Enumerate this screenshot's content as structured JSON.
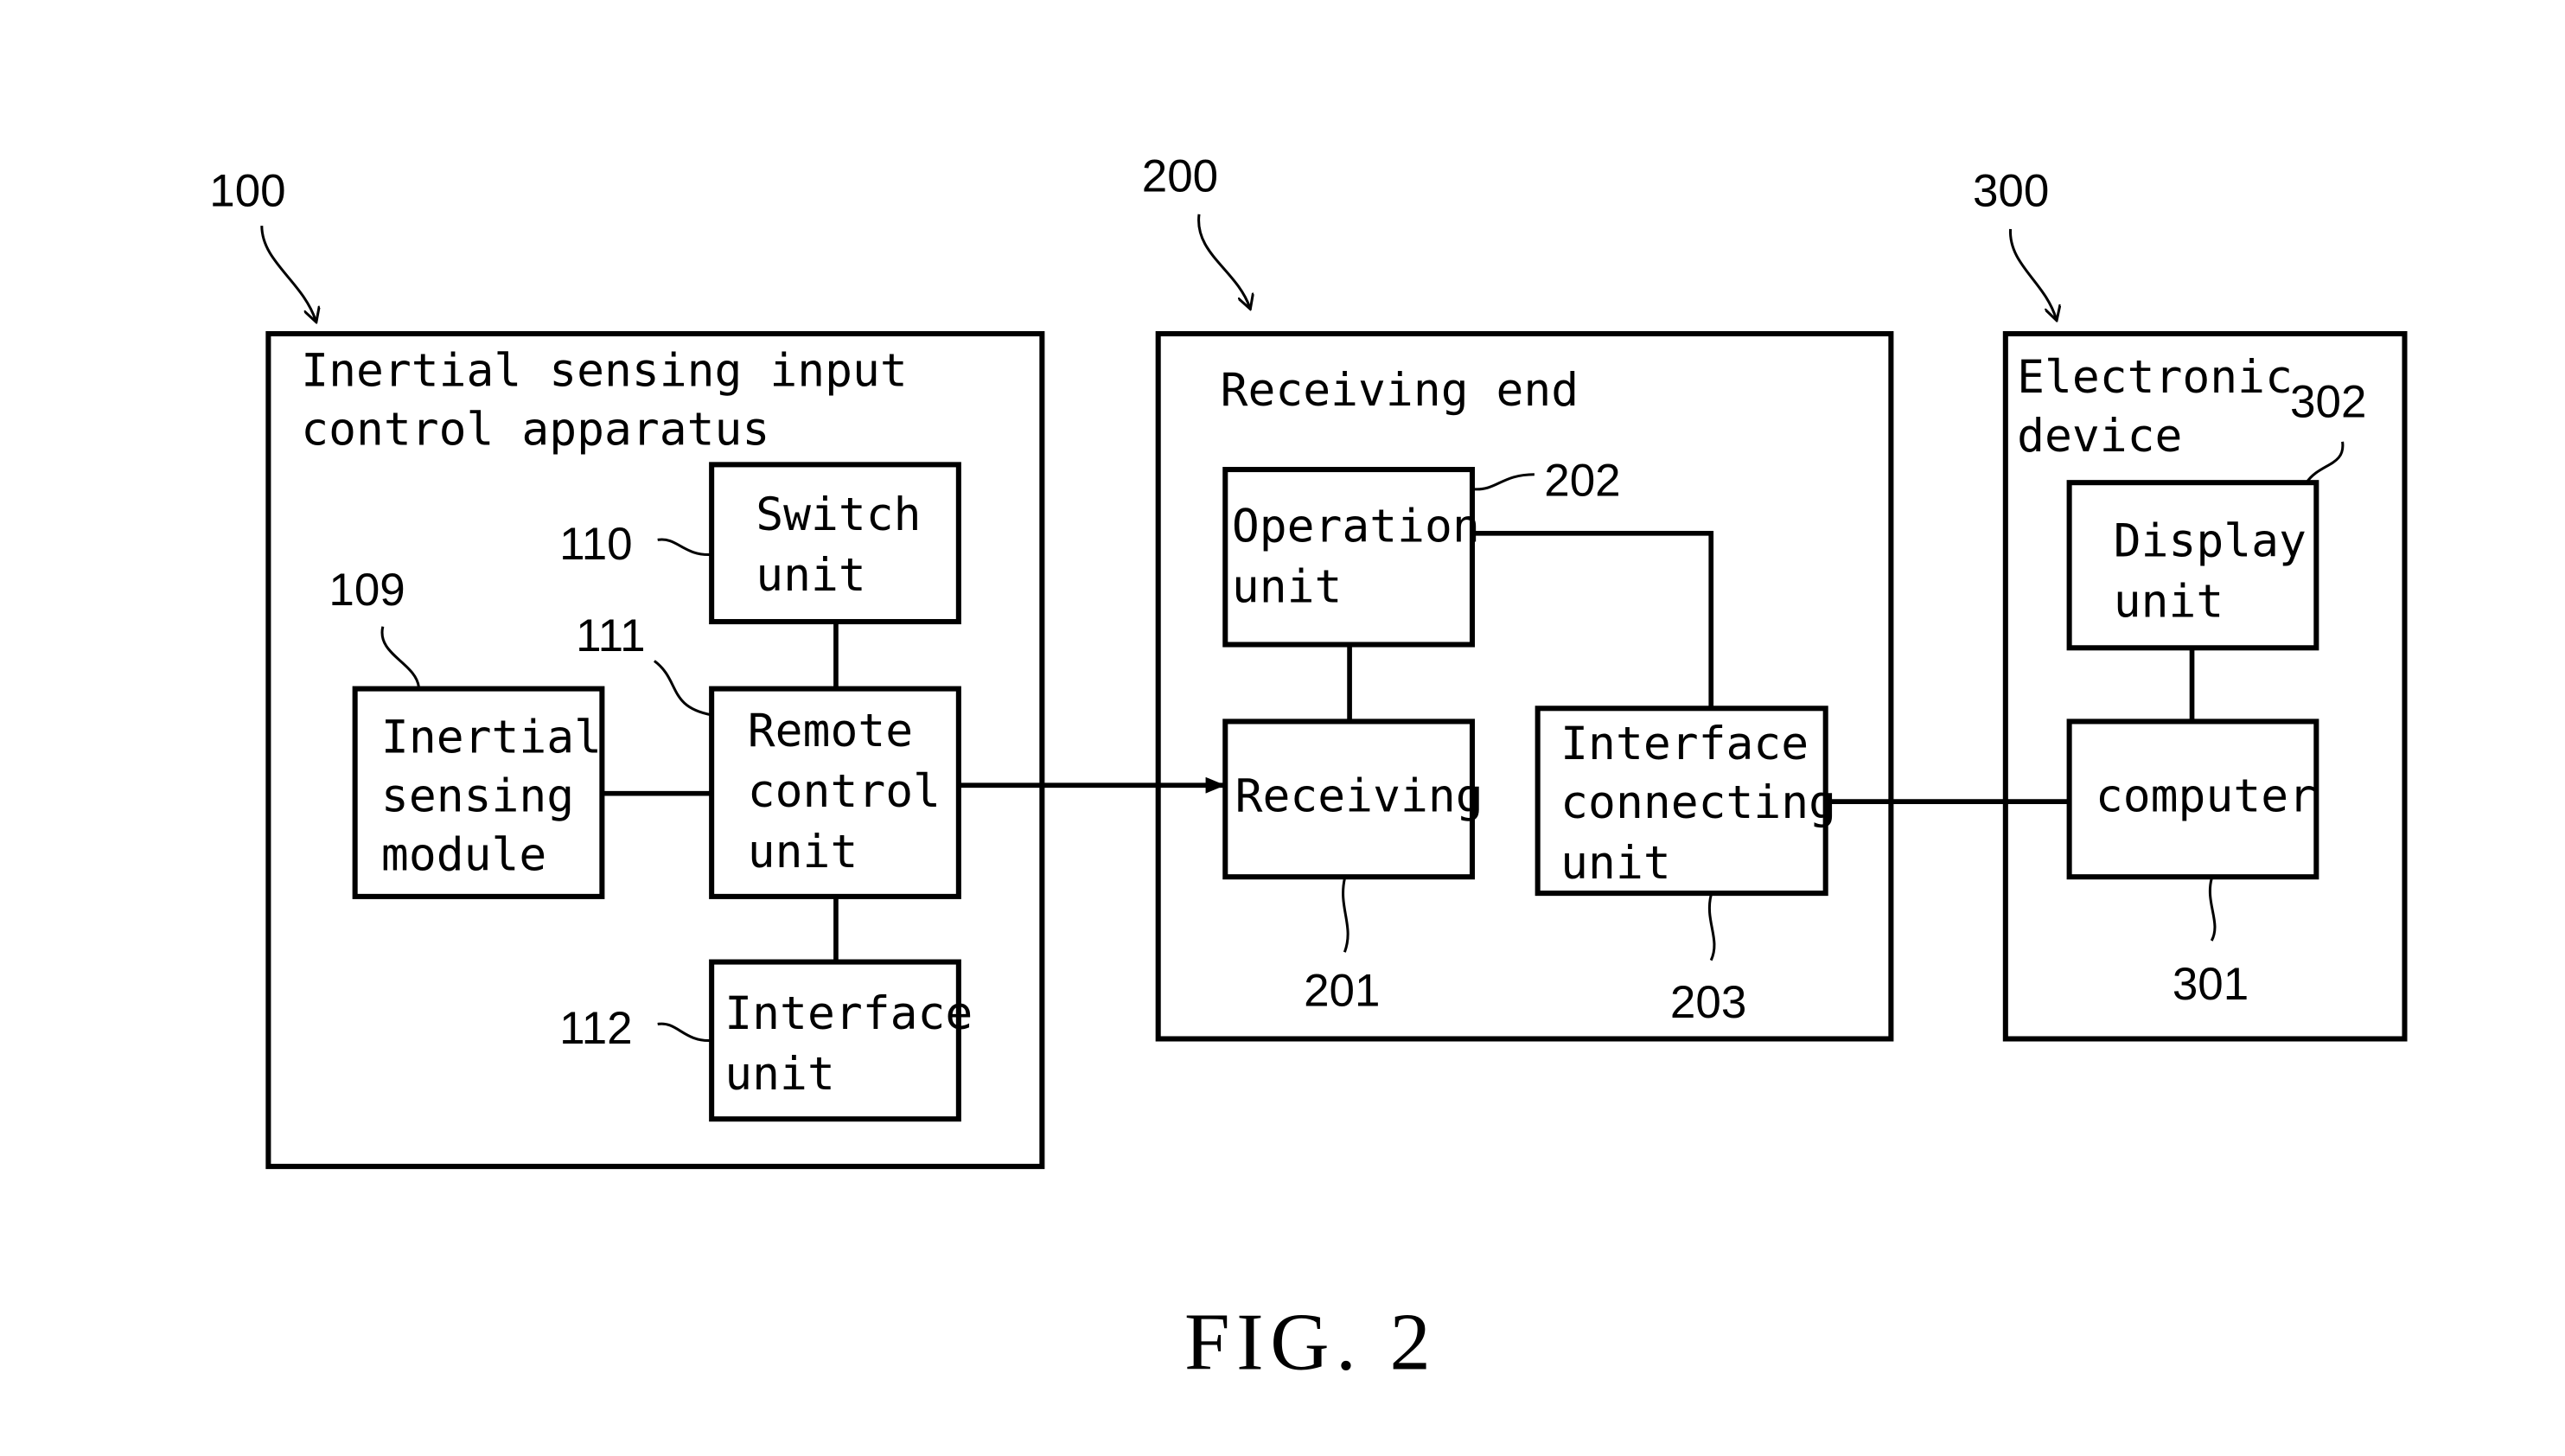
{
  "figure": {
    "caption": "FIG. 2",
    "blocks": {
      "apparatus": {
        "ref": "100",
        "title_lines": [
          "Inertial sensing input",
          "control apparatus"
        ],
        "units": {
          "inertial_sensing_module": {
            "ref": "109",
            "lines": [
              "Inertial",
              "sensing",
              "module"
            ]
          },
          "switch_unit": {
            "ref": "110",
            "lines": [
              "Switch",
              "unit"
            ]
          },
          "remote_control_unit": {
            "ref": "111",
            "lines": [
              "Remote",
              "control",
              "unit"
            ]
          },
          "interface_unit": {
            "ref": "112",
            "lines": [
              "Interface",
              "unit"
            ]
          }
        }
      },
      "receiving_end": {
        "ref": "200",
        "title_lines": [
          "Receiving end"
        ],
        "units": {
          "receiving": {
            "ref": "201",
            "lines": [
              "Receiving"
            ]
          },
          "operation_unit": {
            "ref": "202",
            "lines": [
              "Operation",
              "unit"
            ]
          },
          "interface_connecting_unit": {
            "ref": "203",
            "lines": [
              "Interface",
              "connecting",
              "unit"
            ]
          }
        }
      },
      "electronic_device": {
        "ref": "300",
        "title_lines": [
          "Electronic",
          "device"
        ],
        "units": {
          "computer": {
            "ref": "301",
            "lines": [
              "computer"
            ]
          },
          "display_unit": {
            "ref": "302",
            "lines": [
              "Display",
              "unit"
            ]
          }
        }
      }
    }
  }
}
